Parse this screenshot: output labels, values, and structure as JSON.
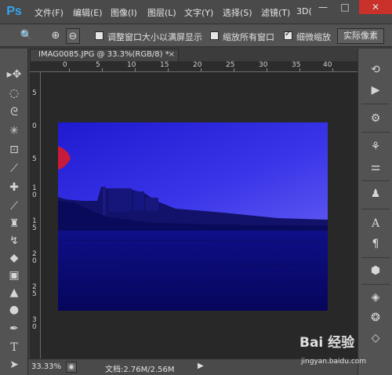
{
  "app": {
    "logo": "Ps"
  },
  "menu": {
    "items": [
      "文件(F)",
      "编辑(E)",
      "图像(I)",
      "图层(L)",
      "文字(Y)",
      "选择(S)",
      "滤镜(T)",
      "3D("
    ],
    "window_buttons": [
      "—",
      "□",
      "✕"
    ]
  },
  "options": {
    "zoom_tool_icon": "🔍",
    "zoom_in_icon": "⊕",
    "zoom_out_icon": "⊖",
    "resize_windows_label": "调整窗口大小以满屏显示",
    "resize_windows_checked": false,
    "zoom_all_windows_label": "缩放所有窗口",
    "zoom_all_windows_checked": false,
    "scrubby_zoom_label": "细微缩放",
    "scrubby_zoom_checked": true,
    "actual_pixels_label": "实际像素"
  },
  "document": {
    "tab_title": "IMAG0085.JPG @ 33.3%(RGB/8) *",
    "tab_close": "×"
  },
  "ruler": {
    "top_labels": [
      "0",
      "5",
      "10",
      "15",
      "20",
      "25",
      "30",
      "35",
      "40"
    ],
    "left_labels": [
      "5",
      "0",
      "5",
      "1 0",
      "1 5",
      "2 0",
      "2 5",
      "3 0"
    ]
  },
  "status": {
    "zoom": "33.33%",
    "doc_info": "文档:2.76M/2.56M",
    "arrow": "▶"
  },
  "toolbar": {
    "tools": [
      "move-tool",
      "marquee-tool",
      "lasso-tool",
      "magic-wand-tool",
      "crop-tool",
      "eyedropper-tool",
      "healing-brush-tool",
      "brush-tool",
      "clone-stamp-tool",
      "history-brush-tool",
      "eraser-tool",
      "gradient-tool",
      "blur-tool",
      "dodge-tool",
      "pen-tool",
      "type-tool",
      "path-selection-tool"
    ]
  },
  "right_panel": {
    "icons": [
      "history-icon",
      "actions-icon",
      "tool-presets-icon",
      "brush-icon",
      "adjust-icon",
      "clone-source-icon",
      "character-icon",
      "paragraph-icon",
      "3d-icon",
      "layers-icon",
      "channels-icon",
      "paths-icon"
    ]
  },
  "watermark": {
    "brand": "Bai 经验",
    "url": "jingyan.baidu.com"
  },
  "colors": {
    "brand": "#32a6f0",
    "close_button": "#c8322a",
    "sky_top": "#2b1fd6",
    "water": "#0a0a78"
  }
}
